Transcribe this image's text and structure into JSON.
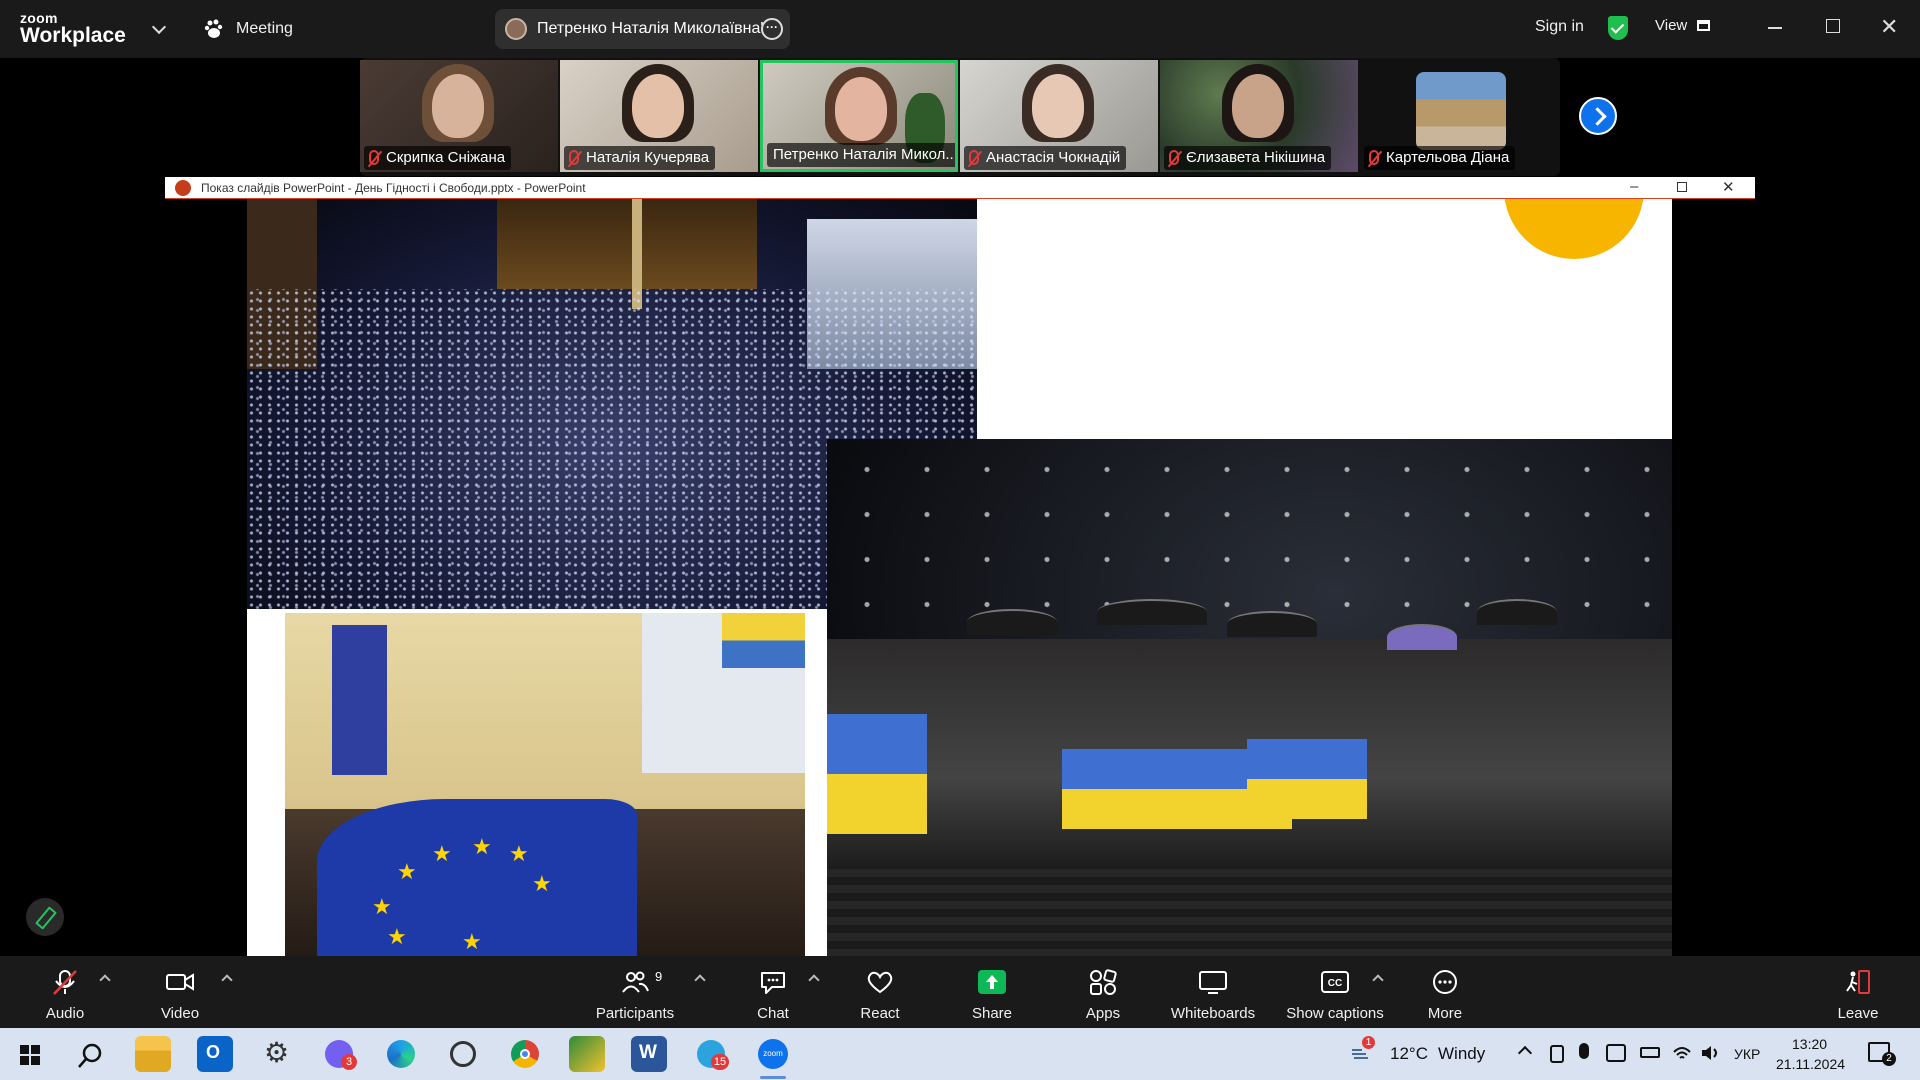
{
  "app": {
    "logo_small": "zoom",
    "logo_big": "Workplace",
    "meeting_label": "Meeting",
    "speaker_name": "Петренко Наталія Миколаївна'",
    "sign_in": "Sign in",
    "view": "View"
  },
  "participants": [
    {
      "name": "Скрипка Сніжана",
      "muted": true
    },
    {
      "name": "Наталія Кучерява",
      "muted": true
    },
    {
      "name": "Петренко Наталія Микол...",
      "muted": false
    },
    {
      "name": "Анастасія Чокнадій",
      "muted": true
    },
    {
      "name": "Єлизавета Нікішина",
      "muted": true
    },
    {
      "name": "Картельова Діана",
      "muted": true
    }
  ],
  "shared_window": {
    "title": "Показ слайдів PowerPoint  -  День Гідності і Свободи.pptx - PowerPoint"
  },
  "toolbar": {
    "audio": "Audio",
    "video": "Video",
    "participants": "Participants",
    "participants_count": "9",
    "chat": "Chat",
    "react": "React",
    "share": "Share",
    "apps": "Apps",
    "whiteboards": "Whiteboards",
    "captions": "Show captions",
    "more": "More",
    "leave": "Leave"
  },
  "taskbar": {
    "weather_temp": "12°C",
    "weather_text": "Windy",
    "language": "УКР",
    "time": "13:20",
    "date": "21.11.2024",
    "notifications": "2",
    "viber_badge": "3",
    "telegram_badge": "15",
    "weather_badge": "1"
  },
  "colors": {
    "accent_green": "#22c55e",
    "zoom_blue": "#0e72ed",
    "mute_red": "#e23a3a",
    "share_green": "#0fb856"
  }
}
